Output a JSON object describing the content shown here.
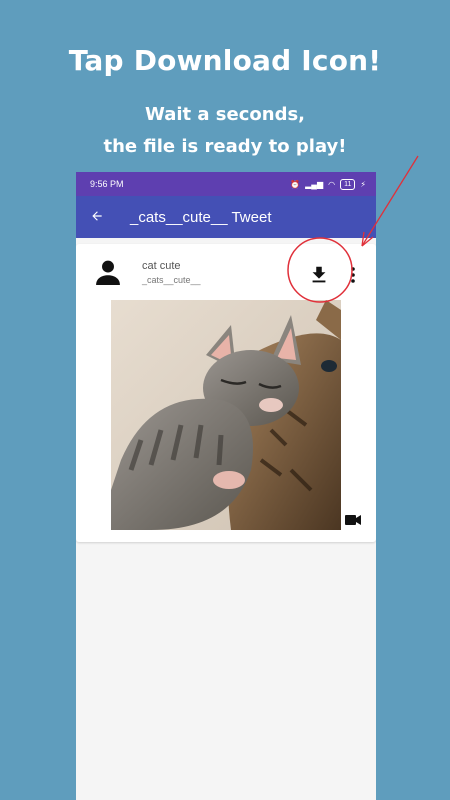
{
  "promo": {
    "headline": "Tap Download Icon!",
    "subline1": "Wait a seconds,",
    "subline2": "the file is ready to play!"
  },
  "status_bar": {
    "time": "9:56 PM",
    "battery": "11"
  },
  "app_bar": {
    "back_icon": "arrow-back-icon",
    "title": "_cats__cute__ Tweet"
  },
  "tweet": {
    "user_name": "cat cute",
    "user_handle": "_cats__cute__",
    "media_type_icon": "video-camera-icon"
  },
  "colors": {
    "background": "#5f9dbd",
    "status_bar": "#5e3fb0",
    "app_bar": "#4450b5",
    "callout": "#e0303a"
  }
}
